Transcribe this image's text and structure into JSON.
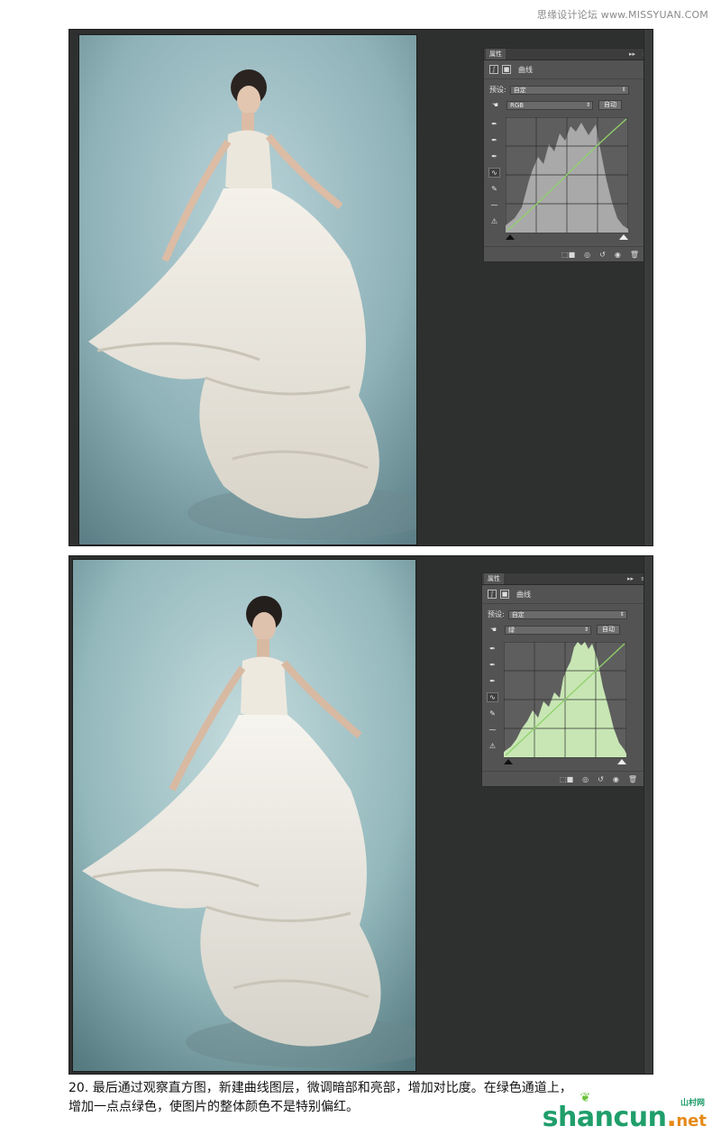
{
  "watermark_top": "思缘设计论坛 www.MISSYUAN.COM",
  "panel1": {
    "tab_label": "属性",
    "collapse_glyph": "▸▸",
    "menu_glyph": "≡",
    "title": "曲线",
    "preset_label": "预设:",
    "preset_value": "自定",
    "channel_value": "RGB",
    "auto_button": "自动",
    "fill_color": "#a9a9a9"
  },
  "panel2": {
    "tab_label": "属性",
    "collapse_glyph": "▸▸",
    "menu_glyph": "≡",
    "title": "曲线",
    "preset_label": "预设:",
    "preset_value": "自定",
    "channel_value": "绿",
    "auto_button": "自动",
    "fill_color": "#c8e6b4"
  },
  "caption": {
    "line1": "20. 最后通过观察直方图，新建曲线图层，微调暗部和亮部，增加对比度。在绿色通道上，",
    "line2": "增加一点点绿色，使图片的整体颜色不是特别偏红。"
  },
  "logo": {
    "main": "shancun",
    "dot": ".",
    "tld": "net",
    "cn": "山村网"
  },
  "icons": {
    "tool_icons": [
      "eyedropper-black",
      "eyedropper-gray",
      "eyedropper-white",
      "curve-tool",
      "pencil-tool",
      "smooth-tool",
      "histogram-warning"
    ],
    "footer_icons": [
      "clip-to-layer",
      "view-previous",
      "reset",
      "visibility",
      "trash"
    ]
  },
  "colors": {
    "workspace_bg": "#2e302f",
    "panel_bg": "#535353",
    "curve_line": "#8fd16b",
    "logo_green": "#1f9e6a",
    "logo_orange": "#e58a1a"
  }
}
